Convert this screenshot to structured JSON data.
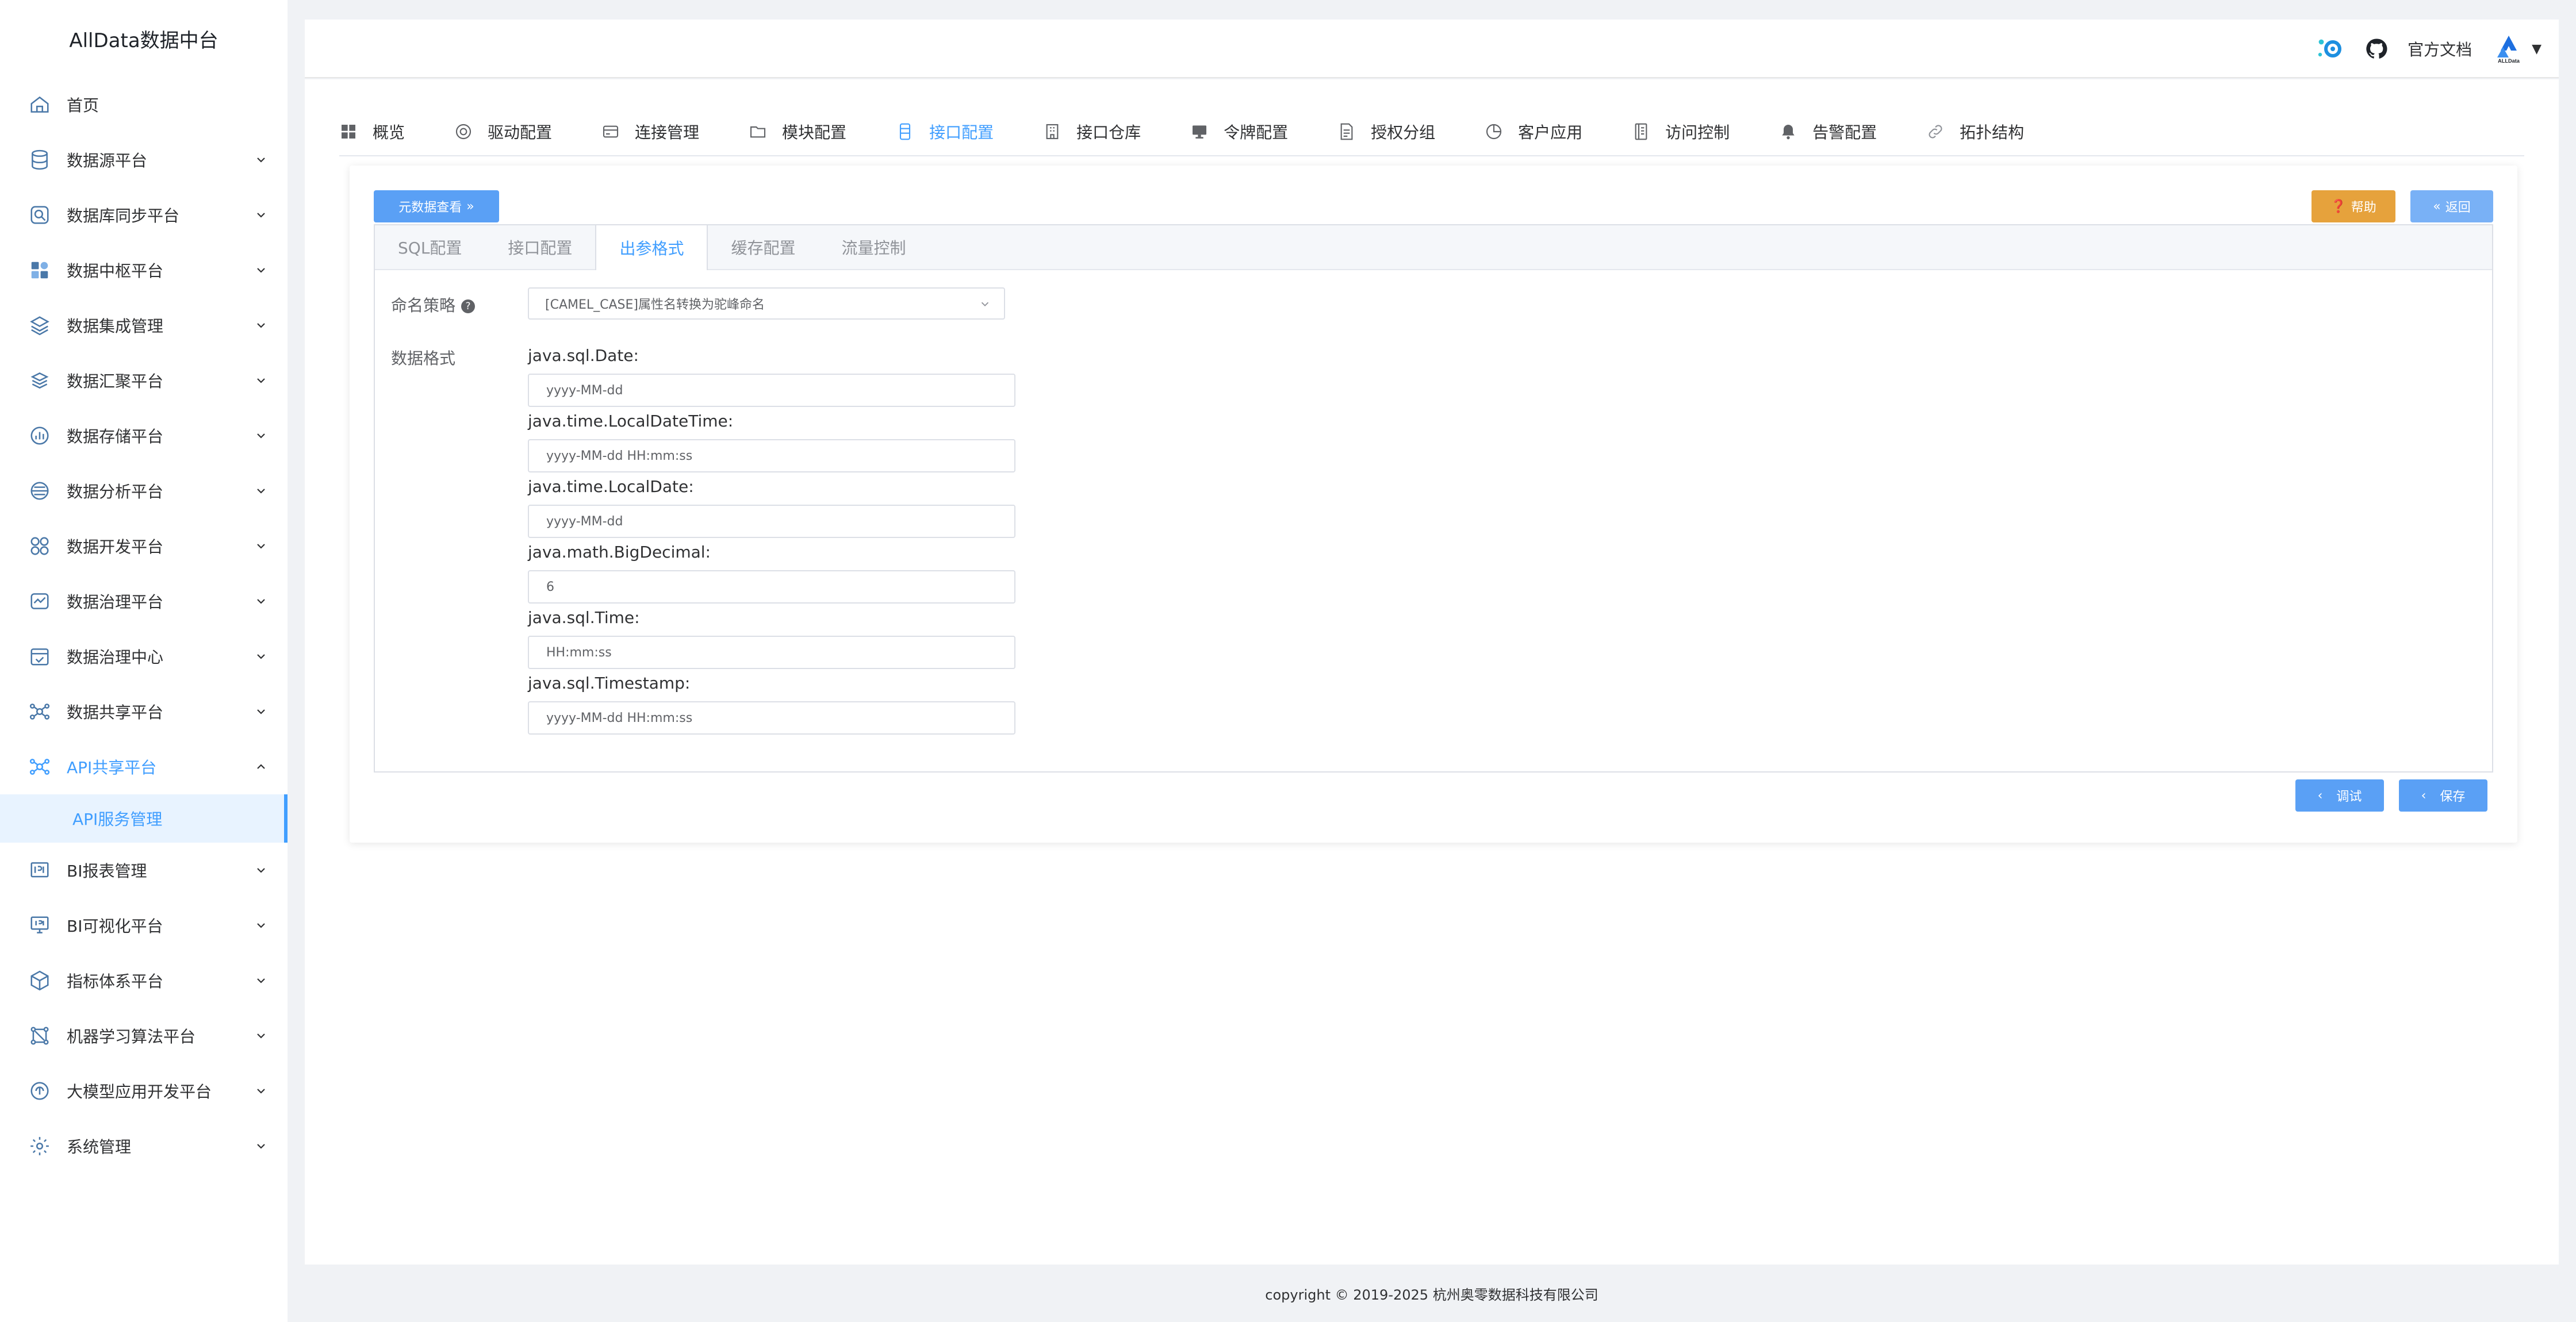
{
  "sidebar": {
    "brand": "AllData数据中台",
    "items": [
      {
        "label": "首页",
        "icon": "home-icon"
      },
      {
        "label": "数据源平台",
        "icon": "database-icon"
      },
      {
        "label": "数据库同步平台",
        "icon": "sync-search-icon"
      },
      {
        "label": "数据中枢平台",
        "icon": "hub-icon"
      },
      {
        "label": "数据集成管理",
        "icon": "layers-icon"
      },
      {
        "label": "数据汇聚平台",
        "icon": "stack-icon"
      },
      {
        "label": "数据存储平台",
        "icon": "storage-chart-icon"
      },
      {
        "label": "数据分析平台",
        "icon": "analysis-icon"
      },
      {
        "label": "数据开发平台",
        "icon": "dev-icon"
      },
      {
        "label": "数据治理平台",
        "icon": "governance-icon"
      },
      {
        "label": "数据治理中心",
        "icon": "calendar-check-icon"
      },
      {
        "label": "数据共享平台",
        "icon": "share-network-icon"
      },
      {
        "label": "API共享平台",
        "icon": "api-network-icon"
      }
    ],
    "active_sub": "API服务管理",
    "items_after": [
      {
        "label": "BI报表管理",
        "icon": "bi-report-icon"
      },
      {
        "label": "BI可视化平台",
        "icon": "bi-monitor-icon"
      },
      {
        "label": "指标体系平台",
        "icon": "cube-icon"
      },
      {
        "label": "机器学习算法平台",
        "icon": "ml-icon"
      },
      {
        "label": "大模型应用开发平台",
        "icon": "llm-icon"
      },
      {
        "label": "系统管理",
        "icon": "settings-icon"
      }
    ]
  },
  "header": {
    "doc_link": "官方文档"
  },
  "top_tabs": [
    {
      "label": "概览",
      "icon": "grid-icon"
    },
    {
      "label": "驱动配置",
      "icon": "driver-icon"
    },
    {
      "label": "连接管理",
      "icon": "card-icon"
    },
    {
      "label": "模块配置",
      "icon": "folder-icon"
    },
    {
      "label": "接口配置",
      "icon": "api-doc-icon"
    },
    {
      "label": "接口仓库",
      "icon": "building-icon"
    },
    {
      "label": "令牌配置",
      "icon": "monitor-icon"
    },
    {
      "label": "授权分组",
      "icon": "document-icon"
    },
    {
      "label": "客户应用",
      "icon": "pie-icon"
    },
    {
      "label": "访问控制",
      "icon": "list-icon"
    },
    {
      "label": "告警配置",
      "icon": "bell-icon"
    },
    {
      "label": "拓扑结构",
      "icon": "link-icon"
    }
  ],
  "active_top_tab": "接口配置",
  "buttons": {
    "meta": "元数据查看",
    "help": "帮助",
    "back": "返回",
    "debug": "调试",
    "save": "保存"
  },
  "inner_tabs": [
    "SQL配置",
    "接口配置",
    "出参格式",
    "缓存配置",
    "流量控制"
  ],
  "active_inner_tab": "出参格式",
  "form": {
    "naming_label": "命名策略",
    "naming_value": "[CAMEL_CASE]属性名转换为驼峰命名",
    "data_format_label": "数据格式",
    "fields": [
      {
        "label": "java.sql.Date:",
        "value": "yyyy-MM-dd"
      },
      {
        "label": "java.time.LocalDateTime:",
        "value": "yyyy-MM-dd HH:mm:ss"
      },
      {
        "label": "java.time.LocalDate:",
        "value": "yyyy-MM-dd"
      },
      {
        "label": "java.math.BigDecimal:",
        "value": "6"
      },
      {
        "label": "java.sql.Time:",
        "value": "HH:mm:ss"
      },
      {
        "label": "java.sql.Timestamp:",
        "value": "yyyy-MM-dd HH:mm:ss"
      }
    ]
  },
  "footer": "copyright © 2019-2025 杭州奥零数据科技有限公司",
  "colors": {
    "accent": "#409eff",
    "warning": "#e6a23c",
    "sidebar_active_bg": "#e8f3ff"
  }
}
